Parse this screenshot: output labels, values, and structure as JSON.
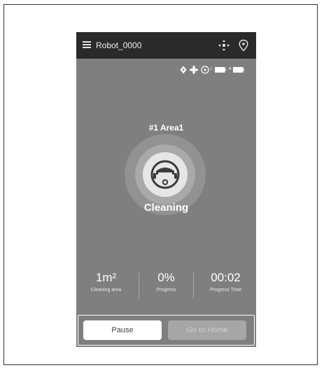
{
  "header": {
    "title": "Robot_0000"
  },
  "status_icons": [
    "direction-icon",
    "fan-icon",
    "sensor-icon",
    "battery-l-icon",
    "battery-r-icon"
  ],
  "battery": {
    "left_label": "L",
    "right_label": "R"
  },
  "main": {
    "area_label": "#1 Area1",
    "state": "Cleaning"
  },
  "stats": [
    {
      "value": "1m²",
      "label": "Cleaning area"
    },
    {
      "value": "0%",
      "label": "Progress"
    },
    {
      "value": "00:02",
      "label": "Progress Time"
    }
  ],
  "actions": {
    "pause_label": "Pause",
    "home_label": "Go to Home"
  },
  "colors": {
    "screen_bg": "#7f7f7f",
    "topbar_bg": "#2a2a2a",
    "text": "#ffffff"
  }
}
